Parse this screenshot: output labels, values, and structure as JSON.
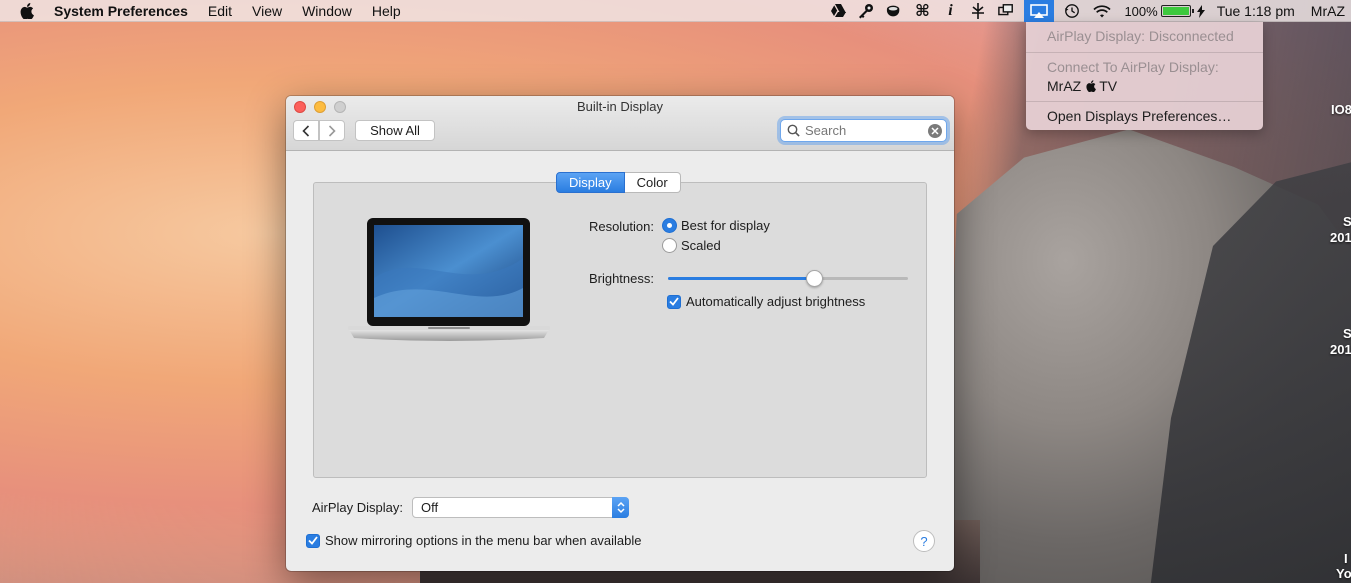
{
  "menubar": {
    "app_name": "System Preferences",
    "menus": [
      "Edit",
      "View",
      "Window",
      "Help"
    ],
    "status_icons": [
      "google-drive-icon",
      "keychain-icon",
      "coffee-icon",
      "command-icon",
      "info-icon",
      "flux-icon",
      "screen-icon",
      "airplay-icon",
      "time-machine-icon",
      "wifi-icon"
    ],
    "battery_percent": "100%",
    "battery_level": 1.0,
    "clock": "Tue 1:18 pm",
    "user": "MrAZ"
  },
  "airplay_menu": {
    "status": "AirPlay Display: Disconnected",
    "connect_heading": "Connect To AirPlay Display:",
    "device_prefix": "MrAZ",
    "device_suffix": "TV",
    "open_prefs": "Open Displays Preferences…"
  },
  "desktop_labels": [
    "IO8",
    "S",
    "201",
    "S",
    "201",
    "I",
    "Yo"
  ],
  "window": {
    "title": "Built-in Display",
    "show_all": "Show All",
    "search_placeholder": "Search",
    "tabs": [
      "Display",
      "Color"
    ],
    "active_tab": "Display",
    "resolution_label": "Resolution:",
    "resolution_options": [
      "Best for display",
      "Scaled"
    ],
    "resolution_selected": "Best for display",
    "brightness_label": "Brightness:",
    "brightness_value": 0.62,
    "auto_brightness_label": "Automatically adjust brightness",
    "auto_brightness_checked": true,
    "airplay_label": "AirPlay Display:",
    "airplay_value": "Off",
    "mirroring_label": "Show mirroring options in the menu bar when available",
    "mirroring_checked": true,
    "help_label": "?"
  },
  "colors": {
    "accent": "#2a7de1",
    "battery": "#3ec93e"
  }
}
